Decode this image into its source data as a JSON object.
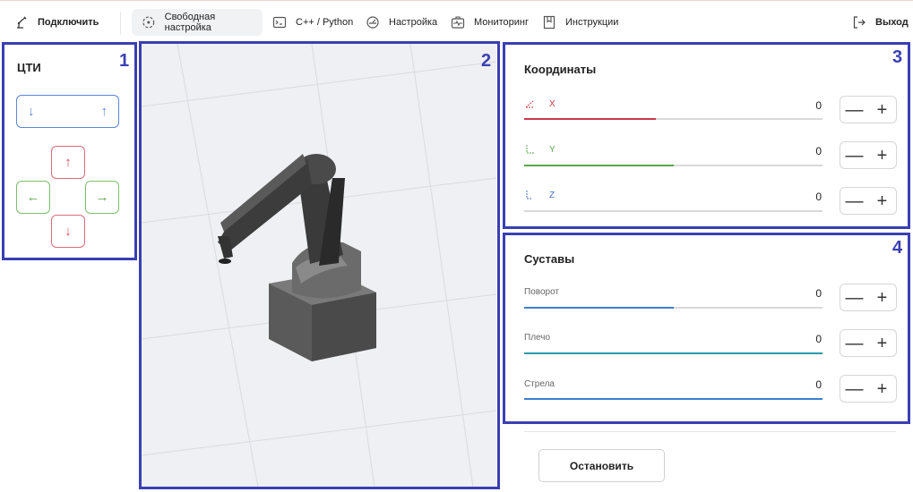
{
  "nav": {
    "connect": "Подключить",
    "free_setup": "Свободная настройка",
    "cpp_python": "C++ / Python",
    "settings": "Настройка",
    "monitoring": "Мониторинг",
    "instructions": "Инструкции",
    "exit": "Выход"
  },
  "markers": [
    "1",
    "2",
    "3",
    "4"
  ],
  "left_panel": {
    "title": "ЦТИ",
    "buttons": {
      "z_down": "↓",
      "z_up": "↑",
      "up": "↑",
      "left": "←",
      "right": "→",
      "down": "↓"
    }
  },
  "coordinates": {
    "title": "Координаты",
    "rows": [
      {
        "label": "X",
        "value": "0",
        "progress": 0.44,
        "color": "#c9384a"
      },
      {
        "label": "Y",
        "value": "0",
        "progress": 0.5,
        "color": "#5aa747"
      },
      {
        "label": "Z",
        "value": "0",
        "progress": 0.0,
        "color": "#4a6fd0"
      }
    ]
  },
  "joints": {
    "title": "Суставы",
    "rows": [
      {
        "label": "Поворот",
        "value": "0",
        "progress": 0.5,
        "color": "#3a7fd0"
      },
      {
        "label": "Плечо",
        "value": "0",
        "progress": 1.0,
        "color": "#2a9aa8"
      },
      {
        "label": "Стрела",
        "value": "0",
        "progress": 1.0,
        "color": "#3a7fd0"
      }
    ]
  },
  "stepper": {
    "minus": "—",
    "plus": "+"
  },
  "stop_button": "Остановить",
  "colors": {
    "frame": "#3a3fb3",
    "active_nav_bg": "#f1f2f4"
  }
}
